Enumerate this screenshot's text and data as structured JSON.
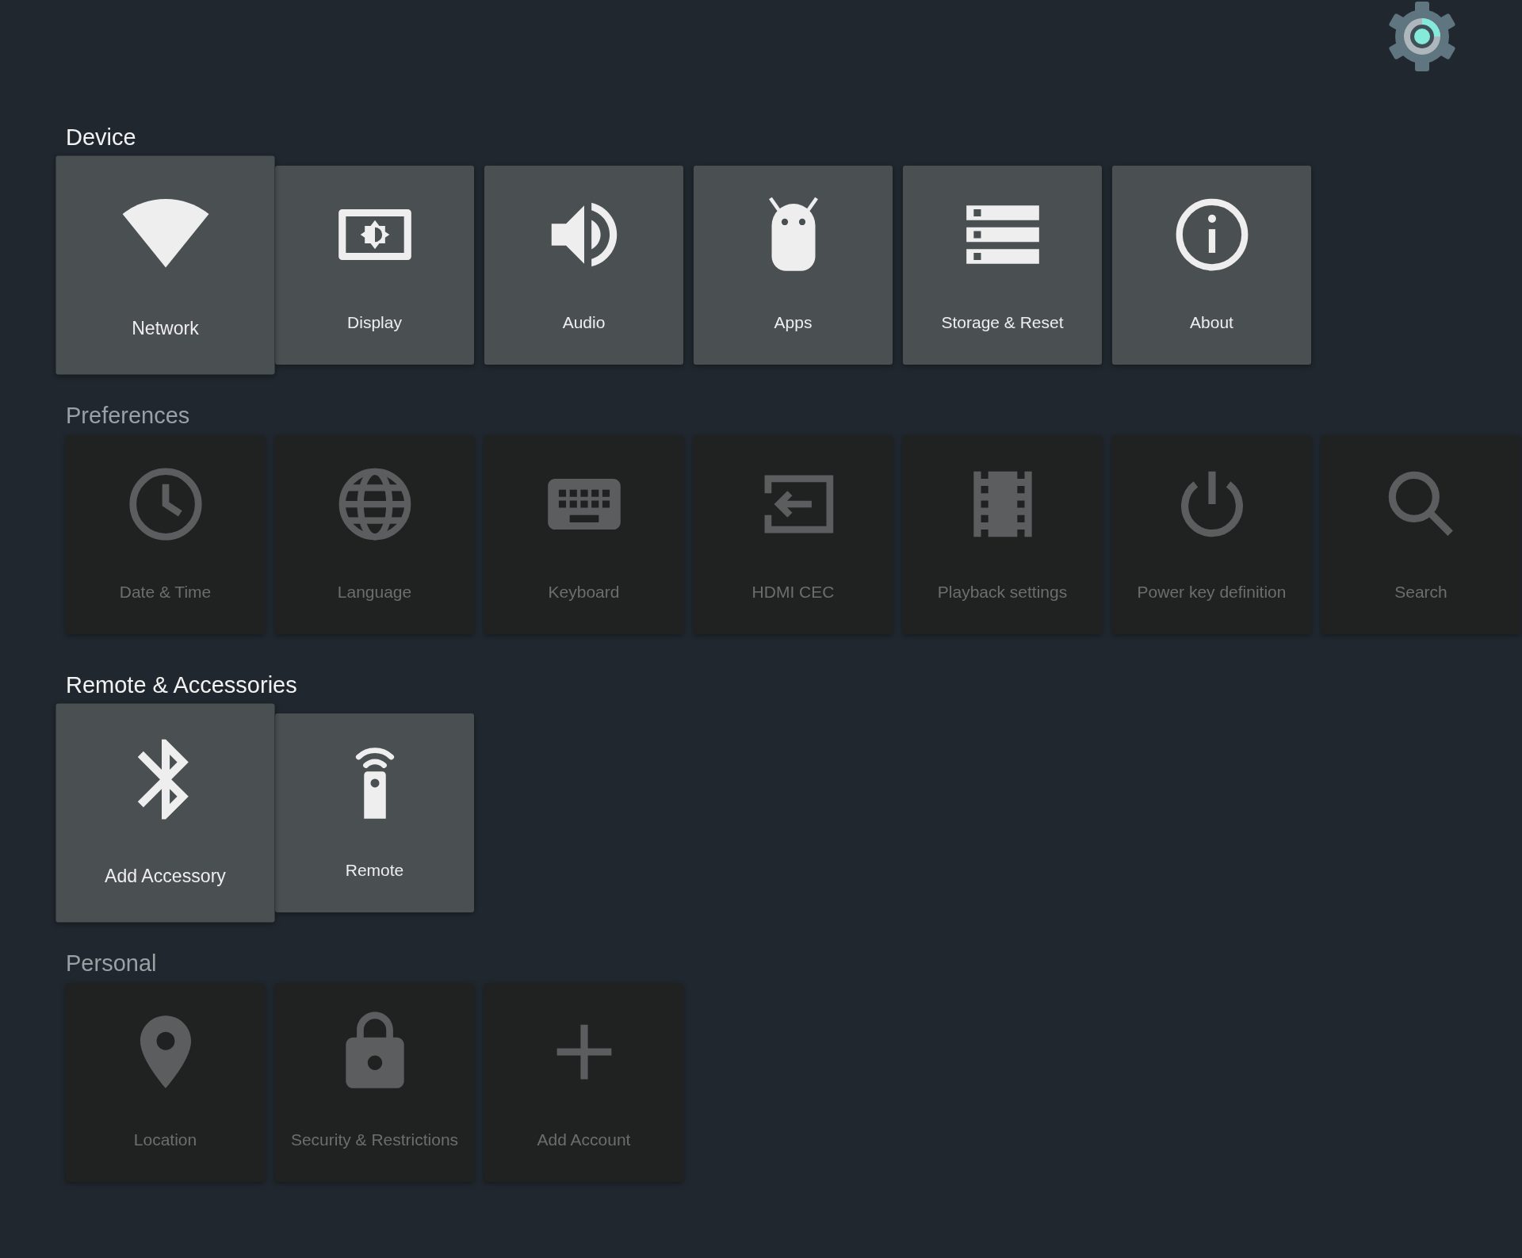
{
  "sections": [
    {
      "title": "Device",
      "focused": true,
      "tiles": [
        {
          "label": "Network",
          "selected": true
        },
        {
          "label": "Display",
          "selected": false
        },
        {
          "label": "Audio",
          "selected": false
        },
        {
          "label": "Apps",
          "selected": false
        },
        {
          "label": "Storage & Reset",
          "selected": false
        },
        {
          "label": "About",
          "selected": false
        }
      ]
    },
    {
      "title": "Preferences",
      "focused": false,
      "tiles": [
        {
          "label": "Date & Time",
          "selected": false
        },
        {
          "label": "Language",
          "selected": false
        },
        {
          "label": "Keyboard",
          "selected": false
        },
        {
          "label": "HDMI CEC",
          "selected": false
        },
        {
          "label": "Playback settings",
          "selected": false
        },
        {
          "label": "Power key definition",
          "selected": false
        },
        {
          "label": "Search",
          "selected": false
        }
      ]
    },
    {
      "title": "Remote & Accessories",
      "focused": true,
      "tiles": [
        {
          "label": "Add Accessory",
          "selected": true
        },
        {
          "label": "Remote",
          "selected": false
        }
      ]
    },
    {
      "title": "Personal",
      "focused": false,
      "tiles": [
        {
          "label": "Location",
          "selected": false
        },
        {
          "label": "Security & Restrictions",
          "selected": false
        },
        {
          "label": "Add Account",
          "selected": false
        }
      ]
    }
  ]
}
